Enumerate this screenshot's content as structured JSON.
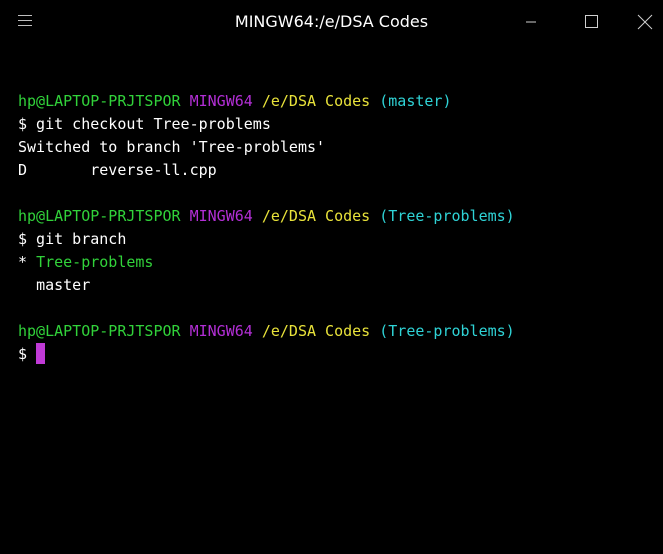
{
  "window": {
    "title": "MINGW64:/e/DSA Codes"
  },
  "colors": {
    "background": "#000000",
    "user": "#31d23a",
    "env": "#b32fd6",
    "path": "#e8e23a",
    "branch": "#2fd3d6",
    "cursor": "#c03ad6"
  },
  "terminal": {
    "prompt1": {
      "user": "hp@LAPTOP-PRJTSPOR",
      "env": "MINGW64",
      "path": "/e/DSA Codes",
      "branch": "(master)"
    },
    "cmd1": "$ git checkout Tree-problems",
    "out1": "Switched to branch 'Tree-problems'",
    "out2_status": "D",
    "out2_file": "reverse-ll.cpp",
    "prompt2": {
      "user": "hp@LAPTOP-PRJTSPOR",
      "env": "MINGW64",
      "path": "/e/DSA Codes",
      "branch": "(Tree-problems)"
    },
    "cmd2": "$ git branch",
    "branch_current_marker": "*",
    "branch_current": "Tree-problems",
    "branch_other": "master",
    "prompt3": {
      "user": "hp@LAPTOP-PRJTSPOR",
      "env": "MINGW64",
      "path": "/e/DSA Codes",
      "branch": "(Tree-problems)"
    },
    "cmd3_prompt": "$"
  },
  "icons": {
    "menu": "hamburger-icon",
    "minimize": "minimize-icon",
    "maximize": "maximize-icon",
    "close": "close-icon"
  }
}
